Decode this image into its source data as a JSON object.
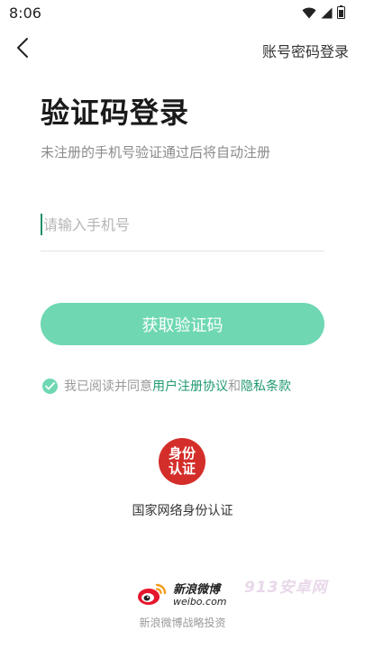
{
  "status_bar": {
    "time": "8:06"
  },
  "header": {
    "back_icon": "chevron-left-icon",
    "account_login": "账号密码登录"
  },
  "main": {
    "title": "验证码登录",
    "subtitle": "未注册的手机号验证通过后将自动注册",
    "phone_placeholder": "请输入手机号",
    "get_code_button": "获取验证码"
  },
  "agreement": {
    "prefix": "我已阅读并同意",
    "user_agreement": "用户注册协议",
    "connector": "和",
    "privacy": "隐私条款"
  },
  "identity": {
    "badge_line1": "身份",
    "badge_line2": "认证",
    "label": "国家网络身份认证"
  },
  "footer": {
    "weibo_cn": "新浪微博",
    "weibo_en": "weibo.com",
    "investment": "新浪微博战略投资",
    "watermark": "913安卓网"
  },
  "colors": {
    "accent": "#6fd8b3",
    "link": "#1f9a6e",
    "badge": "#d42e2a"
  }
}
